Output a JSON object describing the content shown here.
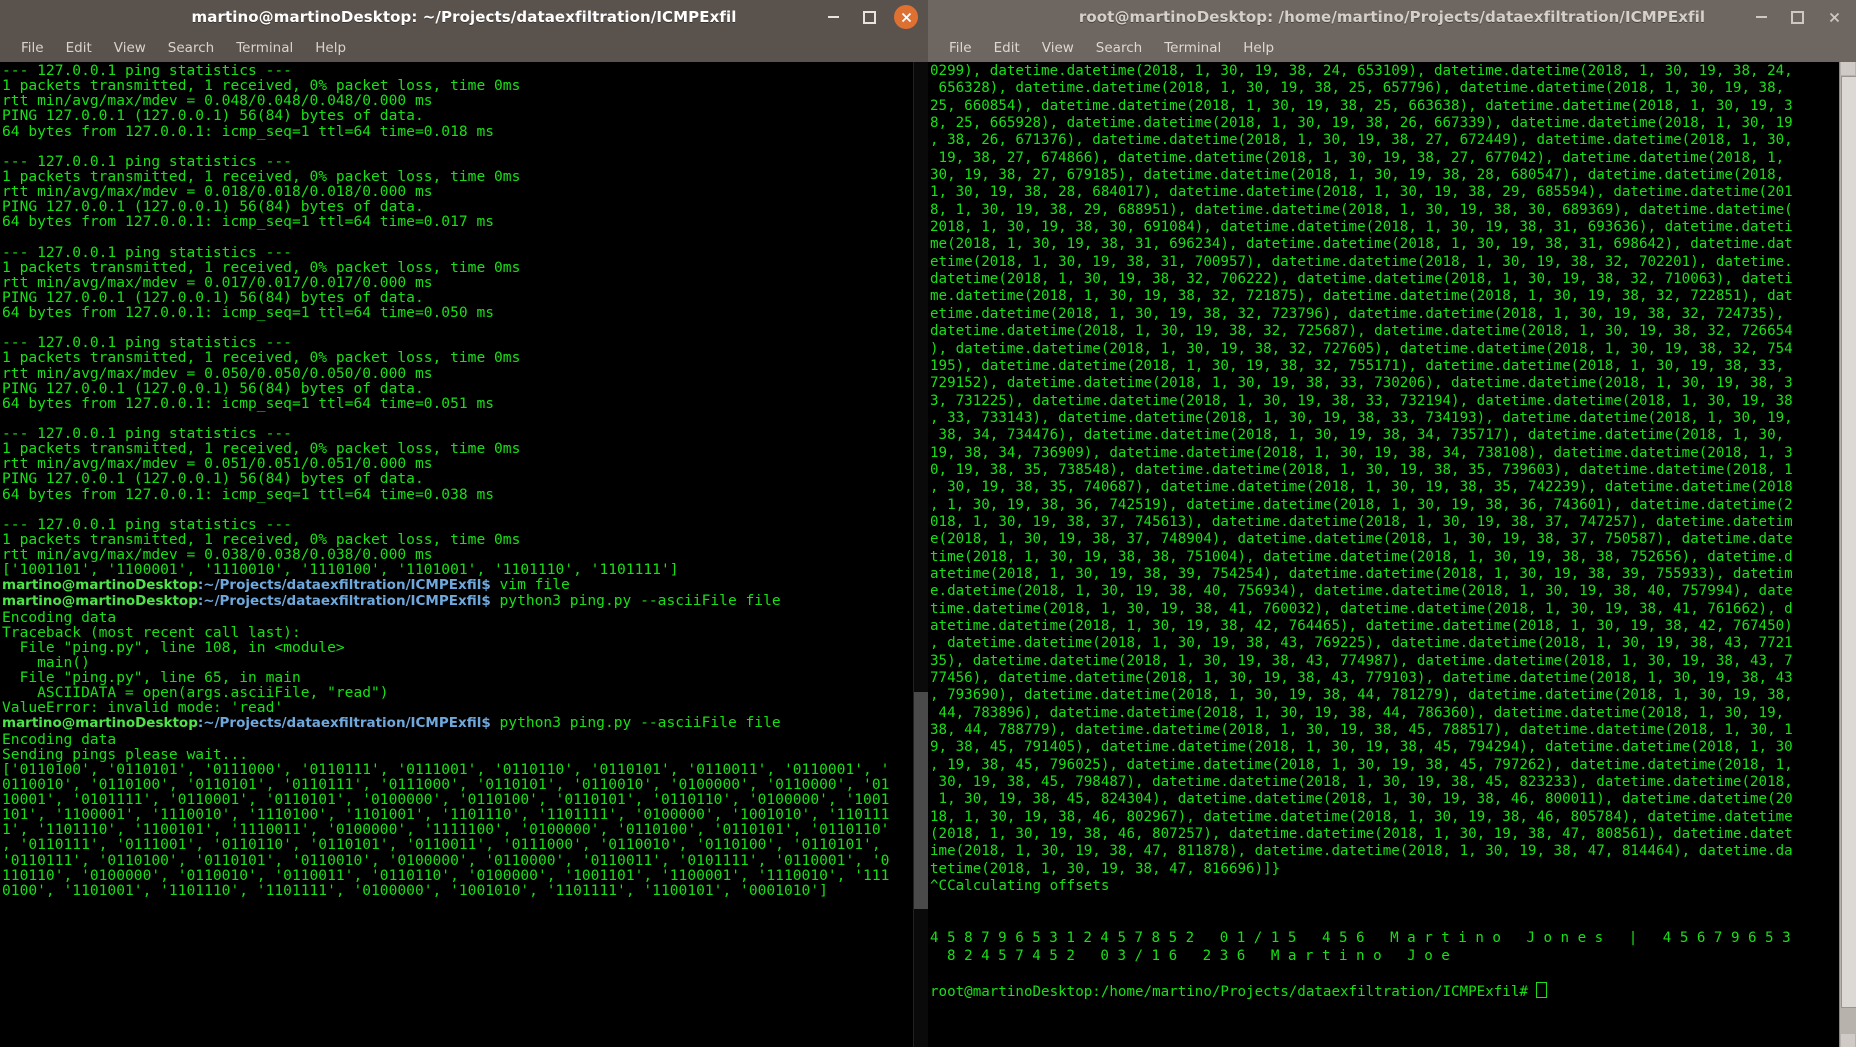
{
  "desktop": {
    "background": "#2b2723"
  },
  "colors": {
    "terminal_bg": "#000000",
    "terminal_fg": "#19e016",
    "titlebar_active": "#5a524c",
    "titlebar_inactive": "#6e6660",
    "close_button": "#de7132",
    "prompt_user": "#4ee34a",
    "prompt_path": "#6fa8dc"
  },
  "left_window": {
    "title": "martino@martinoDesktop: ~/Projects/dataexfiltration/ICMPExfil",
    "focused": true,
    "menu": [
      "File",
      "Edit",
      "View",
      "Search",
      "Terminal",
      "Help"
    ],
    "window_buttons": {
      "minimize": "_",
      "maximize": "□",
      "close": "✕"
    },
    "lines": [
      "--- 127.0.0.1 ping statistics ---",
      "1 packets transmitted, 1 received, 0% packet loss, time 0ms",
      "rtt min/avg/max/mdev = 0.048/0.048/0.048/0.000 ms",
      "PING 127.0.0.1 (127.0.0.1) 56(84) bytes of data.",
      "64 bytes from 127.0.0.1: icmp_seq=1 ttl=64 time=0.018 ms",
      "",
      "--- 127.0.0.1 ping statistics ---",
      "1 packets transmitted, 1 received, 0% packet loss, time 0ms",
      "rtt min/avg/max/mdev = 0.018/0.018/0.018/0.000 ms",
      "PING 127.0.0.1 (127.0.0.1) 56(84) bytes of data.",
      "64 bytes from 127.0.0.1: icmp_seq=1 ttl=64 time=0.017 ms",
      "",
      "--- 127.0.0.1 ping statistics ---",
      "1 packets transmitted, 1 received, 0% packet loss, time 0ms",
      "rtt min/avg/max/mdev = 0.017/0.017/0.017/0.000 ms",
      "PING 127.0.0.1 (127.0.0.1) 56(84) bytes of data.",
      "64 bytes from 127.0.0.1: icmp_seq=1 ttl=64 time=0.050 ms",
      "",
      "--- 127.0.0.1 ping statistics ---",
      "1 packets transmitted, 1 received, 0% packet loss, time 0ms",
      "rtt min/avg/max/mdev = 0.050/0.050/0.050/0.000 ms",
      "PING 127.0.0.1 (127.0.0.1) 56(84) bytes of data.",
      "64 bytes from 127.0.0.1: icmp_seq=1 ttl=64 time=0.051 ms",
      "",
      "--- 127.0.0.1 ping statistics ---",
      "1 packets transmitted, 1 received, 0% packet loss, time 0ms",
      "rtt min/avg/max/mdev = 0.051/0.051/0.051/0.000 ms",
      "PING 127.0.0.1 (127.0.0.1) 56(84) bytes of data.",
      "64 bytes from 127.0.0.1: icmp_seq=1 ttl=64 time=0.038 ms",
      "",
      "--- 127.0.0.1 ping statistics ---",
      "1 packets transmitted, 1 received, 0% packet loss, time 0ms",
      "rtt min/avg/max/mdev = 0.038/0.038/0.038/0.000 ms",
      "['1001101', '1100001', '1110010', '1110100', '1101001', '1101110', '1101111']"
    ],
    "prompt_user": "martino@martinoDesktop",
    "prompt_path": ":~/Projects/dataexfiltration/ICMPExfil$",
    "command_1": " vim file",
    "command_2": " python3 ping.py --asciiFile file",
    "after_cmd1": [],
    "traceback_block": [
      "Encoding data",
      "Traceback (most recent call last):",
      "  File \"ping.py\", line 108, in <module>",
      "    main()",
      "  File \"ping.py\", line 65, in main",
      "    ASCIIDATA = open(args.asciiFile, \"read\")",
      "ValueError: invalid mode: 'read'"
    ],
    "final_block": [
      "Encoding data",
      "Sending pings please wait..."
    ],
    "binary_dump": [
      "['0110100', '0110101', '0111000', '0110111', '0111001', '0110110', '0110101', '0110011', '0110001', '",
      "0110010', '0110100', '0110101', '0110111', '0111000', '0110101', '0110010', '0100000', '0110000', '01",
      "10001', '0101111', '0110001', '0110101', '0100000', '0110100', '0110101', '0110110', '0100000', '1001",
      "101', '1100001', '1110010', '1110100', '1101001', '1101110', '1101111', '0100000', '1001010', '110111",
      "1', '1101110', '1100101', '1110011', '0100000', '1111100', '0100000', '0110100', '0110101', '0110110'",
      ", '0110111', '0111001', '0110110', '0110101', '0110011', '0111000', '0110010', '0110100', '0110101', ",
      "'0110111', '0110100', '0110101', '0110010', '0100000', '0110000', '0110011', '0101111', '0110001', '0",
      "110110', '0100000', '0110010', '0110011', '0110110', '0100000', '1001101', '1100001', '1110010', '111",
      "0100', '1101001', '1101110', '1101111', '0100000', '1001010', '1101111', '1100101', '0001010']"
    ]
  },
  "right_window": {
    "title": "root@martinoDesktop: /home/martino/Projects/dataexfiltration/ICMPExfil",
    "focused": false,
    "menu": [
      "File",
      "Edit",
      "View",
      "Search",
      "Terminal",
      "Help"
    ],
    "window_buttons": {
      "minimize": "_",
      "maximize": "□",
      "close": "✕"
    },
    "lines": [
      "0299), datetime.datetime(2018, 1, 30, 19, 38, 24, 653109), datetime.datetime(2018, 1, 30, 19, 38, 24,",
      " 656328), datetime.datetime(2018, 1, 30, 19, 38, 25, 657796), datetime.datetime(2018, 1, 30, 19, 38,",
      "25, 660854), datetime.datetime(2018, 1, 30, 19, 38, 25, 663638), datetime.datetime(2018, 1, 30, 19, 3",
      "8, 25, 665928), datetime.datetime(2018, 1, 30, 19, 38, 26, 667339), datetime.datetime(2018, 1, 30, 19",
      ", 38, 26, 671376), datetime.datetime(2018, 1, 30, 19, 38, 27, 672449), datetime.datetime(2018, 1, 30,",
      " 19, 38, 27, 674866), datetime.datetime(2018, 1, 30, 19, 38, 27, 677042), datetime.datetime(2018, 1,",
      "30, 19, 38, 27, 679185), datetime.datetime(2018, 1, 30, 19, 38, 28, 680547), datetime.datetime(2018,",
      "1, 30, 19, 38, 28, 684017), datetime.datetime(2018, 1, 30, 19, 38, 29, 685594), datetime.datetime(201",
      "8, 1, 30, 19, 38, 29, 688951), datetime.datetime(2018, 1, 30, 19, 38, 30, 689369), datetime.datetime(",
      "2018, 1, 30, 19, 38, 30, 691084), datetime.datetime(2018, 1, 30, 19, 38, 31, 693636), datetime.dateti",
      "me(2018, 1, 30, 19, 38, 31, 696234), datetime.datetime(2018, 1, 30, 19, 38, 31, 698642), datetime.dat",
      "etime(2018, 1, 30, 19, 38, 31, 700957), datetime.datetime(2018, 1, 30, 19, 38, 32, 702201), datetime.",
      "datetime(2018, 1, 30, 19, 38, 32, 706222), datetime.datetime(2018, 1, 30, 19, 38, 32, 710063), dateti",
      "me.datetime(2018, 1, 30, 19, 38, 32, 721875), datetime.datetime(2018, 1, 30, 19, 38, 32, 722851), dat",
      "etime.datetime(2018, 1, 30, 19, 38, 32, 723796), datetime.datetime(2018, 1, 30, 19, 38, 32, 724735),",
      "datetime.datetime(2018, 1, 30, 19, 38, 32, 725687), datetime.datetime(2018, 1, 30, 19, 38, 32, 726654",
      "), datetime.datetime(2018, 1, 30, 19, 38, 32, 727605), datetime.datetime(2018, 1, 30, 19, 38, 32, 754",
      "195), datetime.datetime(2018, 1, 30, 19, 38, 32, 755171), datetime.datetime(2018, 1, 30, 19, 38, 33,",
      "729152), datetime.datetime(2018, 1, 30, 19, 38, 33, 730206), datetime.datetime(2018, 1, 30, 19, 38, 3",
      "3, 731225), datetime.datetime(2018, 1, 30, 19, 38, 33, 732194), datetime.datetime(2018, 1, 30, 19, 38",
      ", 33, 733143), datetime.datetime(2018, 1, 30, 19, 38, 33, 734193), datetime.datetime(2018, 1, 30, 19,",
      " 38, 34, 734476), datetime.datetime(2018, 1, 30, 19, 38, 34, 735717), datetime.datetime(2018, 1, 30,",
      "19, 38, 34, 736909), datetime.datetime(2018, 1, 30, 19, 38, 34, 738108), datetime.datetime(2018, 1, 3",
      "0, 19, 38, 35, 738548), datetime.datetime(2018, 1, 30, 19, 38, 35, 739603), datetime.datetime(2018, 1",
      ", 30, 19, 38, 35, 740687), datetime.datetime(2018, 1, 30, 19, 38, 35, 742239), datetime.datetime(2018",
      ", 1, 30, 19, 38, 36, 742519), datetime.datetime(2018, 1, 30, 19, 38, 36, 743601), datetime.datetime(2",
      "018, 1, 30, 19, 38, 37, 745613), datetime.datetime(2018, 1, 30, 19, 38, 37, 747257), datetime.datetim",
      "e(2018, 1, 30, 19, 38, 37, 748904), datetime.datetime(2018, 1, 30, 19, 38, 37, 750587), datetime.date",
      "time(2018, 1, 30, 19, 38, 38, 751004), datetime.datetime(2018, 1, 30, 19, 38, 38, 752656), datetime.d",
      "atetime(2018, 1, 30, 19, 38, 39, 754254), datetime.datetime(2018, 1, 30, 19, 38, 39, 755933), datetim",
      "e.datetime(2018, 1, 30, 19, 38, 40, 756934), datetime.datetime(2018, 1, 30, 19, 38, 40, 757994), date",
      "time.datetime(2018, 1, 30, 19, 38, 41, 760032), datetime.datetime(2018, 1, 30, 19, 38, 41, 761662), d",
      "atetime.datetime(2018, 1, 30, 19, 38, 42, 764465), datetime.datetime(2018, 1, 30, 19, 38, 42, 767450)",
      ", datetime.datetime(2018, 1, 30, 19, 38, 43, 769225), datetime.datetime(2018, 1, 30, 19, 38, 43, 7721",
      "35), datetime.datetime(2018, 1, 30, 19, 38, 43, 774987), datetime.datetime(2018, 1, 30, 19, 38, 43, 7",
      "77456), datetime.datetime(2018, 1, 30, 19, 38, 43, 779103), datetime.datetime(2018, 1, 30, 19, 38, 43",
      ", 793690), datetime.datetime(2018, 1, 30, 19, 38, 44, 781279), datetime.datetime(2018, 1, 30, 19, 38,",
      " 44, 783896), datetime.datetime(2018, 1, 30, 19, 38, 44, 786360), datetime.datetime(2018, 1, 30, 19,",
      "38, 44, 788779), datetime.datetime(2018, 1, 30, 19, 38, 45, 788517), datetime.datetime(2018, 1, 30, 1",
      "9, 38, 45, 791405), datetime.datetime(2018, 1, 30, 19, 38, 45, 794294), datetime.datetime(2018, 1, 30",
      ", 19, 38, 45, 796025), datetime.datetime(2018, 1, 30, 19, 38, 45, 797262), datetime.datetime(2018, 1,",
      " 30, 19, 38, 45, 798487), datetime.datetime(2018, 1, 30, 19, 38, 45, 823233), datetime.datetime(2018,",
      " 1, 30, 19, 38, 45, 824304), datetime.datetime(2018, 1, 30, 19, 38, 46, 800011), datetime.datetime(20",
      "18, 1, 30, 19, 38, 46, 802967), datetime.datetime(2018, 1, 30, 19, 38, 46, 805784), datetime.datetime",
      "(2018, 1, 30, 19, 38, 46, 807257), datetime.datetime(2018, 1, 30, 19, 38, 47, 808561), datetime.datet",
      "ime(2018, 1, 30, 19, 38, 47, 811878), datetime.datetime(2018, 1, 30, 19, 38, 47, 814464), datetime.da",
      "tetime(2018, 1, 30, 19, 38, 47, 816696)]}",
      "^CCalculating offsets"
    ],
    "decoded_line_1": "4587965312457852 01/15 456 Martino Jones | 45679653",
    "decoded_line_2": " 82457452 03/16 236 Martino Joe",
    "final_prompt": "root@martinoDesktop:/home/martino/Projects/dataexfiltration/ICMPExfil#"
  }
}
